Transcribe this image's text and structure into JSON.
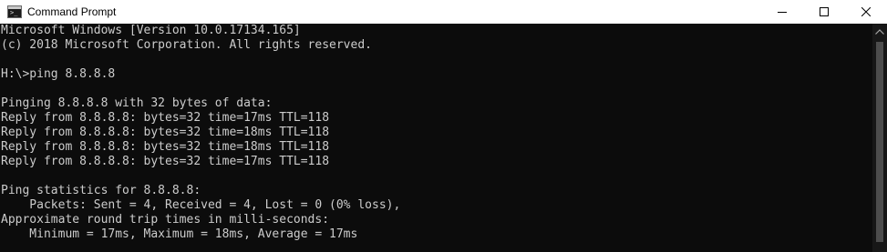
{
  "window": {
    "title": "Command Prompt",
    "app_icon": "cmd-icon",
    "app_icon_glyph": ">_",
    "caption_buttons": [
      "minimize-icon",
      "maximize-icon",
      "close-icon"
    ]
  },
  "console": {
    "lines": [
      "Microsoft Windows [Version 10.0.17134.165]",
      "(c) 2018 Microsoft Corporation. All rights reserved.",
      "",
      "H:\\>ping 8.8.8.8",
      "",
      "Pinging 8.8.8.8 with 32 bytes of data:",
      "Reply from 8.8.8.8: bytes=32 time=17ms TTL=118",
      "Reply from 8.8.8.8: bytes=32 time=18ms TTL=118",
      "Reply from 8.8.8.8: bytes=32 time=18ms TTL=118",
      "Reply from 8.8.8.8: bytes=32 time=17ms TTL=118",
      "",
      "Ping statistics for 8.8.8.8:",
      "    Packets: Sent = 4, Received = 4, Lost = 0 (0% loss),",
      "Approximate round trip times in milli-seconds:",
      "    Minimum = 17ms, Maximum = 18ms, Average = 17ms"
    ]
  },
  "scrollbar": {
    "up_icon": "scroll-up-arrow-icon"
  },
  "colors": {
    "console_background": "#0c0c0c",
    "console_text": "#cccccc",
    "titlebar_background": "#ffffff"
  }
}
